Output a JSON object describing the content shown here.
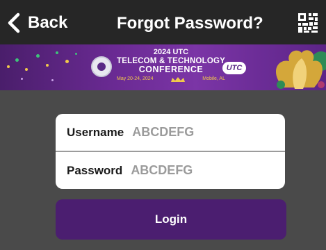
{
  "nav": {
    "back_label": "Back",
    "title": "Forgot Password?",
    "qr_icon": "qr-code-icon"
  },
  "banner": {
    "line1": "2024 UTC",
    "line2": "TELECOM & TECHNOLOGY",
    "line3": "CONFERENCE",
    "dates": "May 20-24, 2024",
    "location": "Mobile, AL",
    "utc_logo": "UTC",
    "colors": {
      "purple": "#6a2a93",
      "gold": "#f1c94a"
    }
  },
  "form": {
    "username_label": "Username",
    "username_placeholder": "ABCDEFG",
    "password_label": "Password",
    "password_placeholder": "ABCDEFG"
  },
  "login": {
    "label": "Login",
    "color": "#4b1e70"
  }
}
